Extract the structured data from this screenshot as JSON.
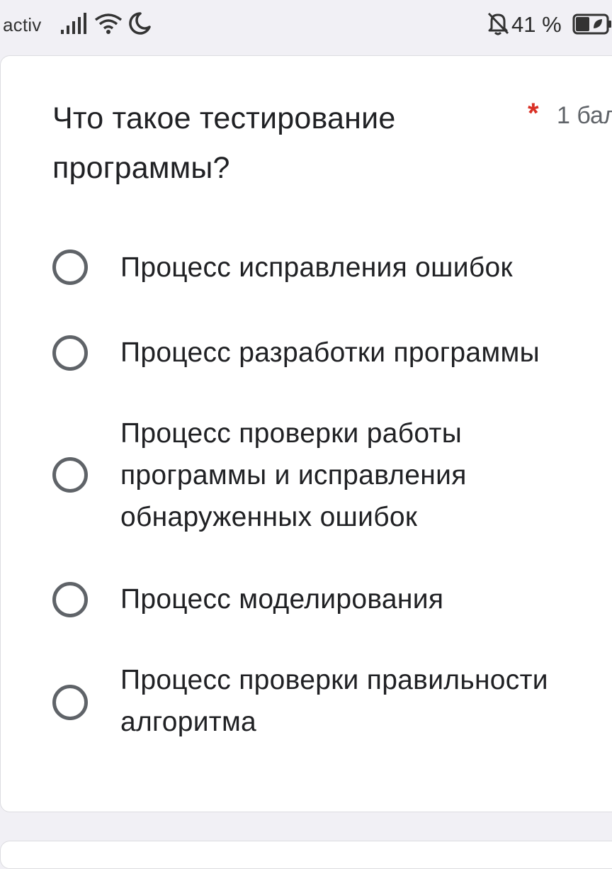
{
  "status_bar": {
    "carrier": "activ",
    "battery_percent": "41 %",
    "icons": [
      "signal-icon",
      "wifi-icon",
      "moon-icon",
      "bell-off-icon",
      "battery-icon"
    ]
  },
  "question": {
    "title": "Что такое тестирование программы?",
    "required_marker": "*",
    "points": "1 бал"
  },
  "options": [
    {
      "label": "Процесс исправления ошибок",
      "selected": false
    },
    {
      "label": "Процесс разработки программы",
      "selected": false
    },
    {
      "label": "Процесс проверки работы программы и исправления обнаруженных ошибок",
      "selected": false
    },
    {
      "label": "Процесс моделирования",
      "selected": false
    },
    {
      "label": "Процесс проверки правильности алгоритма",
      "selected": false
    }
  ],
  "colors": {
    "required": "#d93025",
    "radio_border": "#5f6368",
    "text": "#202124",
    "page_bg": "#f1f0f5"
  }
}
